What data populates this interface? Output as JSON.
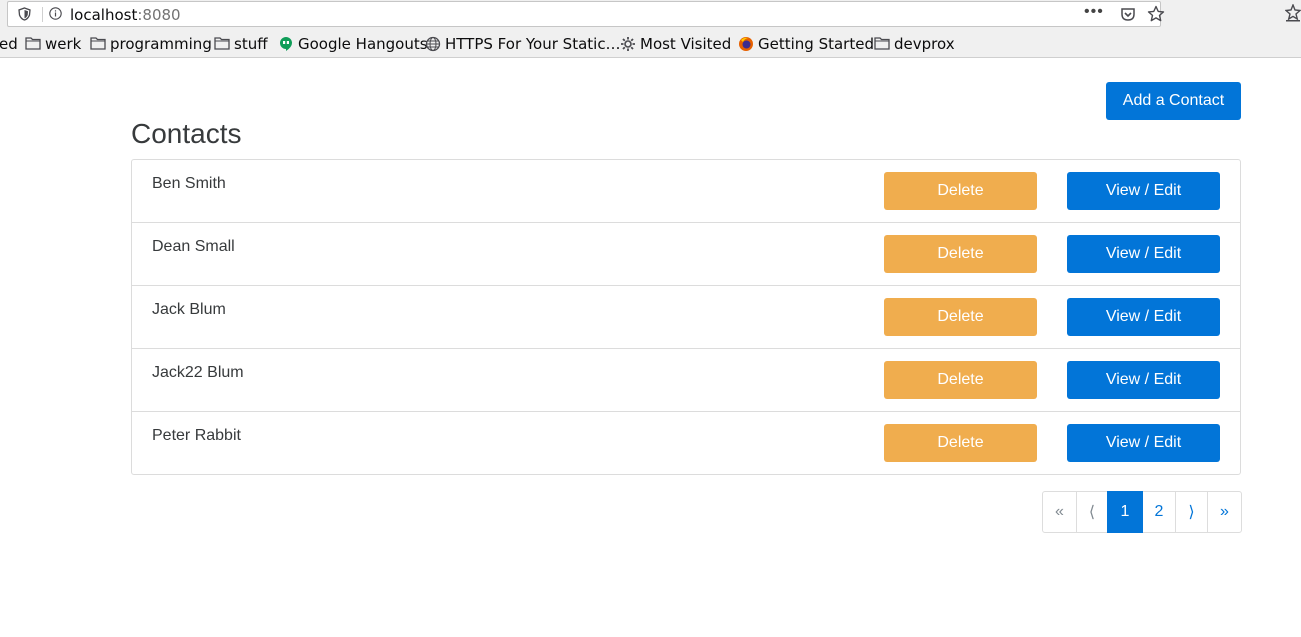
{
  "browser": {
    "url_host": "localhost",
    "url_port": ":8080",
    "page_actions_label": "•••",
    "bookmarks": [
      {
        "label": "ed",
        "icon": "none"
      },
      {
        "label": "werk",
        "icon": "folder-icon"
      },
      {
        "label": "programming",
        "icon": "folder-icon"
      },
      {
        "label": "stuff",
        "icon": "folder-icon"
      },
      {
        "label": "Google Hangouts",
        "icon": "hangouts-icon"
      },
      {
        "label": "HTTPS For Your Static…",
        "icon": "globe-icon"
      },
      {
        "label": "Most Visited",
        "icon": "gear-icon"
      },
      {
        "label": "Getting Started",
        "icon": "firefox-icon"
      },
      {
        "label": "devprox",
        "icon": "folder-icon"
      }
    ]
  },
  "page": {
    "add_contact_label": "Add a Contact",
    "title": "Contacts",
    "contacts": [
      {
        "name": "Ben Smith",
        "delete_label": "Delete",
        "edit_label": "View / Edit"
      },
      {
        "name": "Dean Small",
        "delete_label": "Delete",
        "edit_label": "View / Edit"
      },
      {
        "name": "Jack Blum",
        "delete_label": "Delete",
        "edit_label": "View / Edit"
      },
      {
        "name": "Jack22 Blum",
        "delete_label": "Delete",
        "edit_label": "View / Edit"
      },
      {
        "name": "Peter Rabbit",
        "delete_label": "Delete",
        "edit_label": "View / Edit"
      }
    ],
    "pagination": {
      "first": "«",
      "prev": "⟨",
      "pages": [
        "1",
        "2"
      ],
      "current_page": "1",
      "next": "⟩",
      "last": "»"
    }
  },
  "colors": {
    "primary": "#0275d8",
    "warning": "#f0ad4e",
    "text": "#373a3c"
  }
}
